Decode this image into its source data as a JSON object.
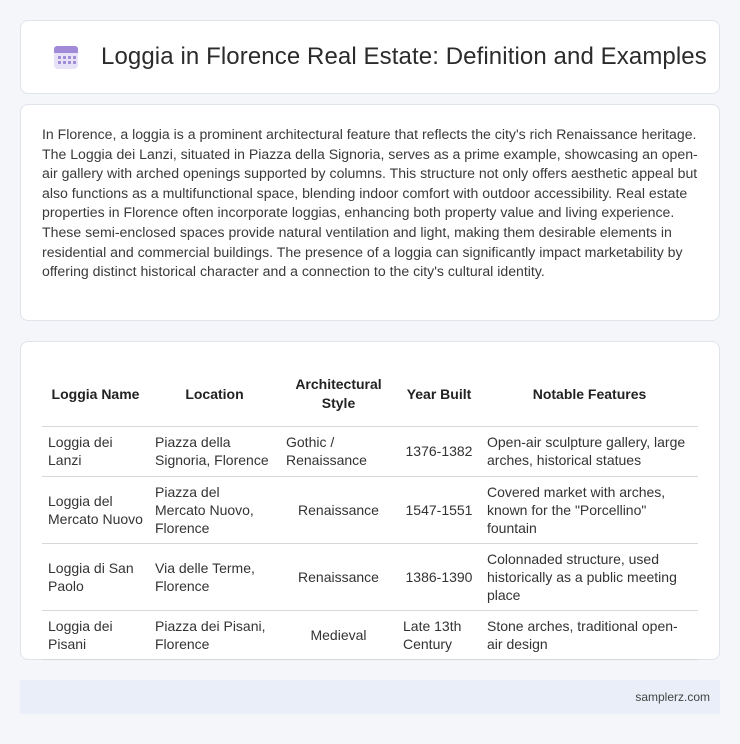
{
  "header": {
    "title": "Loggia in Florence Real Estate: Definition and Examples",
    "icon": "calendar-icon"
  },
  "intro": {
    "text": "In Florence, a loggia is a prominent architectural feature that reflects the city's rich Renaissance heritage. The Loggia dei Lanzi, situated in Piazza della Signoria, serves as a prime example, showcasing an open-air gallery with arched openings supported by columns. This structure not only offers aesthetic appeal but also functions as a multifunctional space, blending indoor comfort with outdoor accessibility. Real estate properties in Florence often incorporate loggias, enhancing both property value and living experience. These semi-enclosed spaces provide natural ventilation and light, making them desirable elements in residential and commercial buildings. The presence of a loggia can significantly impact marketability by offering distinct historical character and a connection to the city's cultural identity."
  },
  "table": {
    "headers": [
      "Loggia Name",
      "Location",
      "Architectural Style",
      "Year Built",
      "Notable Features"
    ],
    "rows": [
      [
        "Loggia dei Lanzi",
        "Piazza della Signoria, Florence",
        "Gothic / Renaissance",
        "1376-1382",
        "Open-air sculpture gallery, large arches, historical statues"
      ],
      [
        "Loggia del Mercato Nuovo",
        "Piazza del Mercato Nuovo, Florence",
        "Renaissance",
        "1547-1551",
        "Covered market with arches, known for the \"Porcellino\" fountain"
      ],
      [
        "Loggia di San Paolo",
        "Via delle Terme, Florence",
        "Renaissance",
        "1386-1390",
        "Colonnaded structure, used historically as a public meeting place"
      ],
      [
        "Loggia dei Pisani",
        "Piazza dei Pisani, Florence",
        "Medieval",
        "Late 13th Century",
        "Stone arches, traditional open-air design"
      ]
    ]
  },
  "footer": {
    "text": "samplerz.com"
  },
  "colors": {
    "icon_header": "#a18ad8",
    "icon_body": "#e8e2f8",
    "icon_dots": "#9d8bd6"
  }
}
